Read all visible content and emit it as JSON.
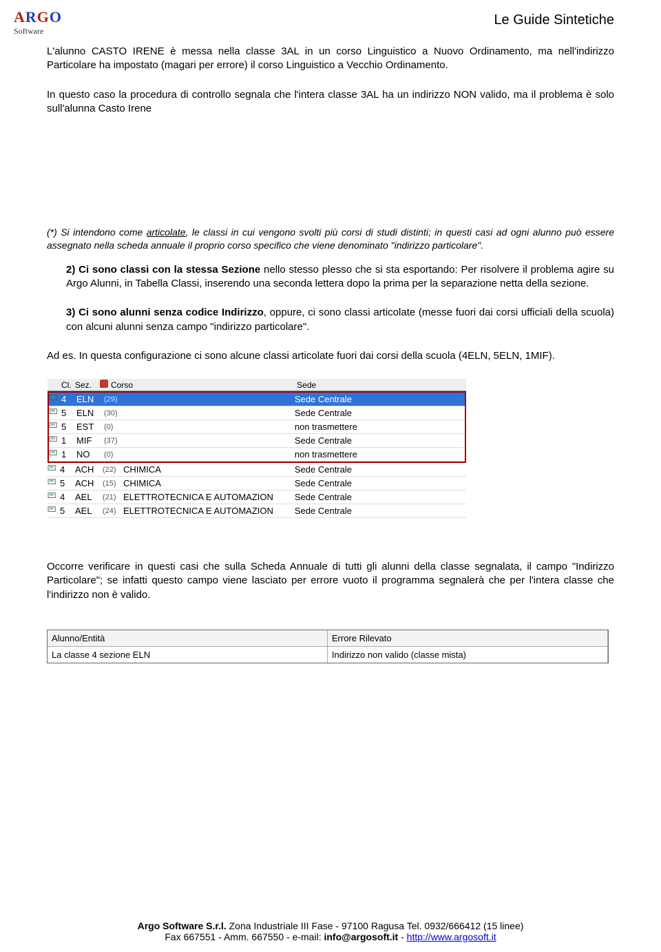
{
  "logo": {
    "text": "ARGO",
    "subtitle": "Software"
  },
  "header": {
    "title": "Le Guide Sintetiche"
  },
  "p1": "L'alunno CASTO IRENE è messa nella classe 3AL in un corso Linguistico a Nuovo Ordinamento, ma nell'indirizzo Particolare ha impostato (magari per  errore) il corso Linguistico a Vecchio Ordinamento.",
  "p2": "In questo caso la procedura di controllo segnala che l'intera classe 3AL ha un indirizzo  NON valido, ma il problema è solo sull'alunna Casto Irene",
  "p3_prefix": "(*) Si intendono come ",
  "p3_underline": "articolate",
  "p3_rest": ", le classi in cui vengono svolti più corsi di studi distinti; in questi casi ad ogni alunno può essere assegnato nella scheda annuale il proprio corso specifico che viene denominato \"indirizzo particolare\".",
  "li2_bold": "2)  Ci sono classi con la stessa Sezione",
  "li2_rest": " nello stesso plesso che si sta esportando: Per risolvere il problema agire su Argo Alunni, in Tabella Classi, inserendo una seconda lettera dopo la prima per la separazione netta della sezione.",
  "li3_bold": "3)  Ci sono alunni senza codice Indirizzo",
  "li3_rest": ", oppure, ci sono classi articolate (messe fuori dai corsi ufficiali della scuola) con alcuni alunni senza campo \"indirizzo particolare\".",
  "p4": "Ad es. In questa configurazione ci sono alcune classi articolate fuori dai corsi della scuola (4ELN, 5ELN, 1MIF).",
  "table": {
    "headers": {
      "cl": "Cl.",
      "sez": "Sez.",
      "corso": "Corso",
      "sede": "Sede"
    },
    "rows": [
      {
        "sel": true,
        "cl": "4",
        "sez": "ELN",
        "cnt": "(29)",
        "corso": "",
        "sede": "Sede Centrale",
        "box": true
      },
      {
        "sel": false,
        "cl": "5",
        "sez": "ELN",
        "cnt": "(30)",
        "corso": "",
        "sede": "Sede Centrale",
        "box": true
      },
      {
        "sel": false,
        "cl": "5",
        "sez": "EST",
        "cnt": "(0)",
        "corso": "",
        "sede": "non trasmettere",
        "box": true
      },
      {
        "sel": false,
        "cl": "1",
        "sez": "MIF",
        "cnt": "(37)",
        "corso": "",
        "sede": "Sede Centrale",
        "box": true
      },
      {
        "sel": false,
        "cl": "1",
        "sez": "NO",
        "cnt": "(0)",
        "corso": "",
        "sede": "non trasmettere",
        "box": true
      },
      {
        "sel": false,
        "cl": "4",
        "sez": "ACH",
        "cnt": "(22)",
        "corso": "CHIMICA",
        "sede": "Sede Centrale",
        "box": false
      },
      {
        "sel": false,
        "cl": "5",
        "sez": "ACH",
        "cnt": "(15)",
        "corso": "CHIMICA",
        "sede": "Sede Centrale",
        "box": false
      },
      {
        "sel": false,
        "cl": "4",
        "sez": "AEL",
        "cnt": "(21)",
        "corso": "ELETTROTECNICA E AUTOMAZION",
        "sede": "Sede Centrale",
        "box": false
      },
      {
        "sel": false,
        "cl": "5",
        "sez": "AEL",
        "cnt": "(24)",
        "corso": "ELETTROTECNICA E AUTOMAZION",
        "sede": "Sede Centrale",
        "box": false
      }
    ]
  },
  "p5": "Occorre verificare in questi casi che sulla Scheda Annuale di tutti gli alunni della classe segnalata, il campo \"Indirizzo Particolare\"; se infatti questo campo viene lasciato per errore vuoto il programma segnalerà che per l'intera classe che l'indirizzo non è valido.",
  "err": {
    "h1": "Alunno/Entità",
    "h2": "Errore Rilevato",
    "c1": "La classe 4 sezione ELN",
    "c2": "Indirizzo non valido (classe mista)"
  },
  "footer": {
    "l1_bold": "Argo Software S.r.l.",
    "l1_rest": " Zona Industriale III Fase - 97100 Ragusa Tel. 0932/666412 (15 linee)",
    "l2_a": "Fax 667551 - Amm. 667550 - e-mail: ",
    "l2_mail": "info@argosoft.it",
    "l2_b": " - ",
    "l2_url": "http://www.argosoft.it"
  }
}
